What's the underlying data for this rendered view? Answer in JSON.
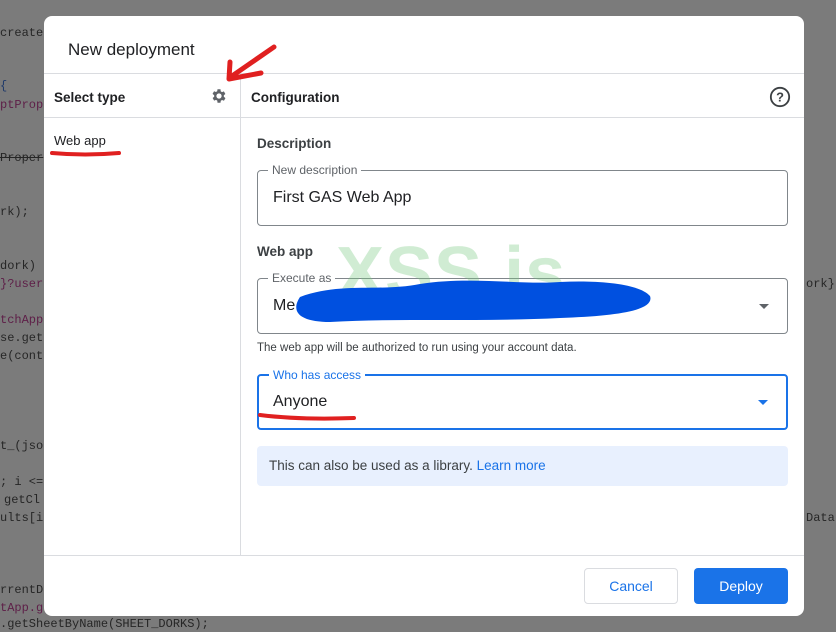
{
  "background_code": {
    "left": [
      "create",
      "{",
      "ptProp",
      "Proper",
      "rk);",
      "dork)",
      "}?user",
      "tchApp",
      "se.get",
      "e(cont",
      "t_(jso",
      "; i <=",
      "getCl",
      "ults[i",
      "rrentD",
      "tApp.g",
      ".getSheetByName(SHEET_DORKS);"
    ],
    "right": [
      "ork}",
      "Data"
    ]
  },
  "dialog": {
    "title": "New deployment",
    "select_type": "Select type",
    "configuration": "Configuration",
    "types": [
      "Web app"
    ],
    "description_section": "Description",
    "description_field": {
      "label": "New description",
      "value": "First GAS Web App"
    },
    "webapp_section": "Web app",
    "execute_as": {
      "label": "Execute as",
      "value": "Me"
    },
    "execute_hint": "The web app will be authorized to run using your account data.",
    "who_has_access": {
      "label": "Who has access",
      "value": "Anyone"
    },
    "info_text": "This can also be used as a library.",
    "info_link": "Learn more",
    "cancel": "Cancel",
    "deploy": "Deploy"
  },
  "watermark": "XSS.is",
  "colors": {
    "accent": "#1a73e8",
    "annotation_red": "#e02020",
    "redaction_blue": "#0050e0"
  }
}
